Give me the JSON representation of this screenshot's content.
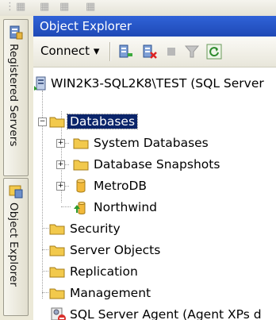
{
  "panel": {
    "title": "Object Explorer",
    "connect_label": "Connect",
    "connect_arrow": "▾"
  },
  "dock": {
    "registered_servers": "Registered Servers",
    "object_explorer": "Object Explorer"
  },
  "tree": {
    "server": "WIN2K3-SQL2K8\\TEST (SQL Server",
    "databases": "Databases",
    "system_databases": "System Databases",
    "database_snapshots": "Database Snapshots",
    "metrodb": "MetroDB",
    "northwind": "Northwind",
    "security": "Security",
    "server_objects": "Server Objects",
    "replication": "Replication",
    "management": "Management",
    "sql_agent": "SQL Server Agent (Agent XPs d"
  },
  "colors": {
    "titlebar": "#2f62d8",
    "selection": "#0a246a",
    "folder": "#f2c94c"
  }
}
